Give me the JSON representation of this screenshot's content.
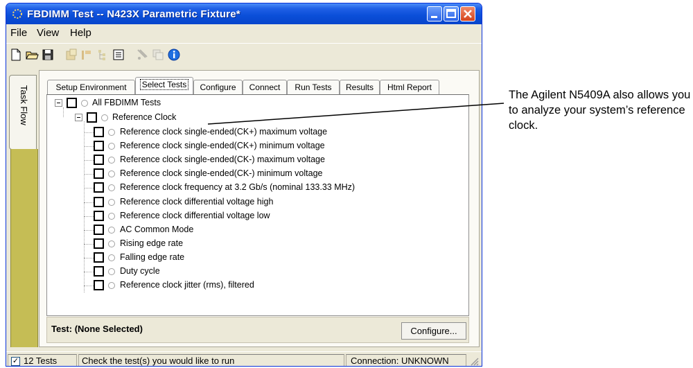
{
  "window": {
    "title": "FBDIMM Test -- N423X Parametric Fixture*"
  },
  "menu": [
    "File",
    "View",
    "Help"
  ],
  "toolbar": {
    "icons": [
      "new-file-icon",
      "open-folder-icon",
      "save-icon",
      "properties-icon",
      "marker-icon",
      "tree-view-icon",
      "list-view-icon",
      "copy-icon",
      "paste-icon",
      "info-icon"
    ]
  },
  "taskflow": {
    "label": "Task Flow"
  },
  "tabs": [
    "Setup Environment",
    "Select Tests",
    "Configure",
    "Connect",
    "Run Tests",
    "Results",
    "Html Report"
  ],
  "active_tab": "Select Tests",
  "tree": {
    "root": "All FBDIMM Tests",
    "group": "Reference Clock",
    "tests": [
      "Reference clock single-ended(CK+) maximum voltage",
      "Reference clock single-ended(CK+) minimum voltage",
      "Reference clock single-ended(CK-) maximum voltage",
      "Reference clock single-ended(CK-) minimum voltage",
      "Reference clock frequency at 3.2 Gb/s (nominal 133.33 MHz)",
      "Reference clock differential voltage high",
      "Reference clock differential voltage low",
      "AC Common Mode",
      "Rising edge rate",
      "Falling edge rate",
      "Duty cycle",
      "Reference clock jitter (rms), filtered"
    ]
  },
  "test_status": "Test: (None Selected)",
  "configure_button": "Configure...",
  "statusbar": {
    "count": "12 Tests",
    "message": "Check the test(s) you would like to run",
    "connection": "Connection: UNKNOWN"
  },
  "callout": "The Agilent N5409A also allows you to analyze your system’s reference clock."
}
